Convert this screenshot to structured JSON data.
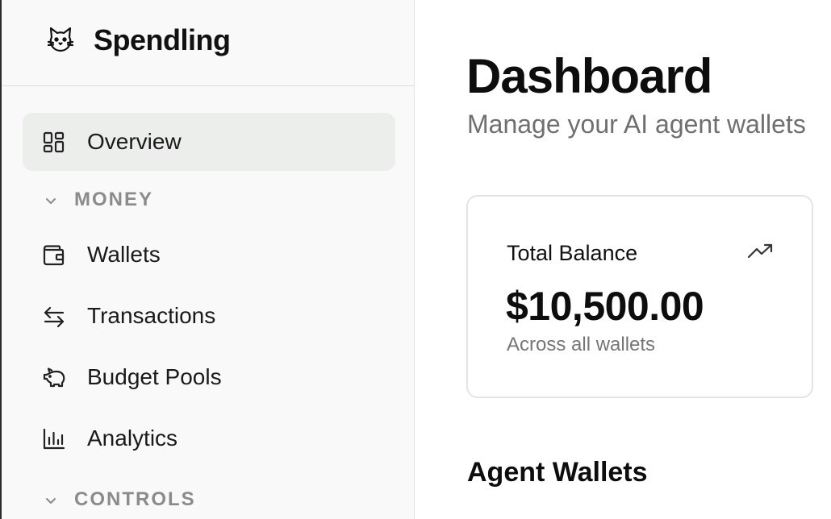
{
  "app": {
    "name": "Spendling",
    "logo_icon": "cat-logo-icon"
  },
  "sidebar": {
    "items": [
      {
        "label": "Overview",
        "icon": "grid-icon",
        "active": true
      }
    ],
    "sections": [
      {
        "title": "MONEY",
        "expanded": true,
        "items": [
          {
            "label": "Wallets",
            "icon": "wallet-icon"
          },
          {
            "label": "Transactions",
            "icon": "arrows-swap-icon"
          },
          {
            "label": "Budget Pools",
            "icon": "piggy-bank-icon"
          },
          {
            "label": "Analytics",
            "icon": "bar-chart-icon"
          }
        ]
      },
      {
        "title": "CONTROLS",
        "expanded": true,
        "items": []
      }
    ]
  },
  "main": {
    "title": "Dashboard",
    "subtitle": "Manage your AI agent wallets",
    "balance_card": {
      "label": "Total Balance",
      "value": "$10,500.00",
      "caption": "Across all wallets",
      "icon": "trending-up-icon"
    },
    "wallets_section": {
      "title": "Agent Wallets"
    }
  },
  "colors": {
    "sidebar_bg": "#f8f9f8",
    "active_item_bg": "#eceeec",
    "section_label": "#8a8c8a",
    "muted_text": "#6e706e",
    "card_border": "#e3e5e3"
  }
}
